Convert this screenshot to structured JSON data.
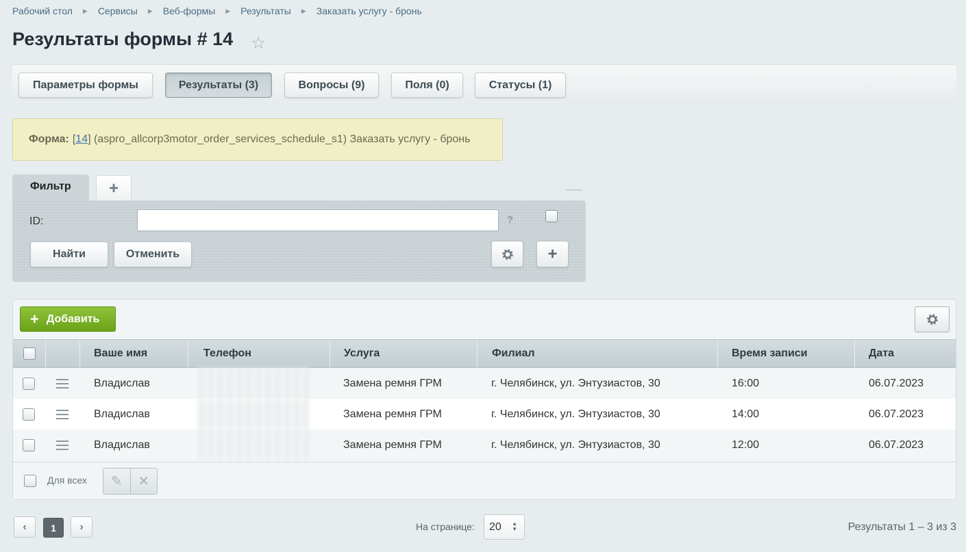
{
  "breadcrumb": [
    "Рабочий стол",
    "Сервисы",
    "Веб-формы",
    "Результаты",
    "Заказать услугу - бронь"
  ],
  "page_title": "Результаты формы # 14",
  "tabs": [
    {
      "label": "Параметры формы",
      "active": false
    },
    {
      "label": "Результаты (3)",
      "active": true
    },
    {
      "label": "Вопросы (9)",
      "active": false
    },
    {
      "label": "Поля (0)",
      "active": false
    },
    {
      "label": "Статусы (1)",
      "active": false
    }
  ],
  "notice": {
    "label": "Форма:",
    "bracket_open": "[",
    "form_id": "14",
    "rest": "] (aspro_allcorp3motor_order_services_schedule_s1) Заказать услугу - бронь"
  },
  "filter": {
    "tab_label": "Фильтр",
    "add_tab": "+",
    "collapse": "—",
    "field_label": "ID:",
    "field_value": "",
    "help": "?",
    "find_label": "Найти",
    "cancel_label": "Отменить",
    "add_field": "+"
  },
  "grid": {
    "add_label": "Добавить",
    "columns": [
      "Ваше имя",
      "Телефон",
      "Услуга",
      "Филиал",
      "Время записи",
      "Дата"
    ],
    "rows": [
      {
        "name": "Владислав",
        "service": "Замена ремня ГРМ",
        "branch": "г. Челябинск, ул. Энтузиастов, 30",
        "time": "16:00",
        "date": "06.07.2023"
      },
      {
        "name": "Владислав",
        "service": "Замена ремня ГРМ",
        "branch": "г. Челябинск, ул. Энтузиастов, 30",
        "time": "14:00",
        "date": "06.07.2023"
      },
      {
        "name": "Владислав",
        "service": "Замена ремня ГРМ",
        "branch": "г. Челябинск, ул. Энтузиастов, 30",
        "time": "12:00",
        "date": "06.07.2023"
      }
    ],
    "for_all_label": "Для всех"
  },
  "pagination": {
    "prev": "‹",
    "current_page": "1",
    "next": "›",
    "per_page_label": "На странице:",
    "per_page_value": "20",
    "results_text": "Результаты 1 – 3 из 3"
  },
  "colors": {
    "background": "#e7edee",
    "add_button": "#7bb227",
    "notice_bg": "#f1efc6",
    "link": "#3f74b2"
  },
  "icons": [
    "star-icon",
    "plus-icon",
    "minus-icon",
    "gear-icon",
    "menu-icon",
    "edit-icon",
    "delete-icon",
    "chevron-left-icon",
    "chevron-right-icon"
  ]
}
